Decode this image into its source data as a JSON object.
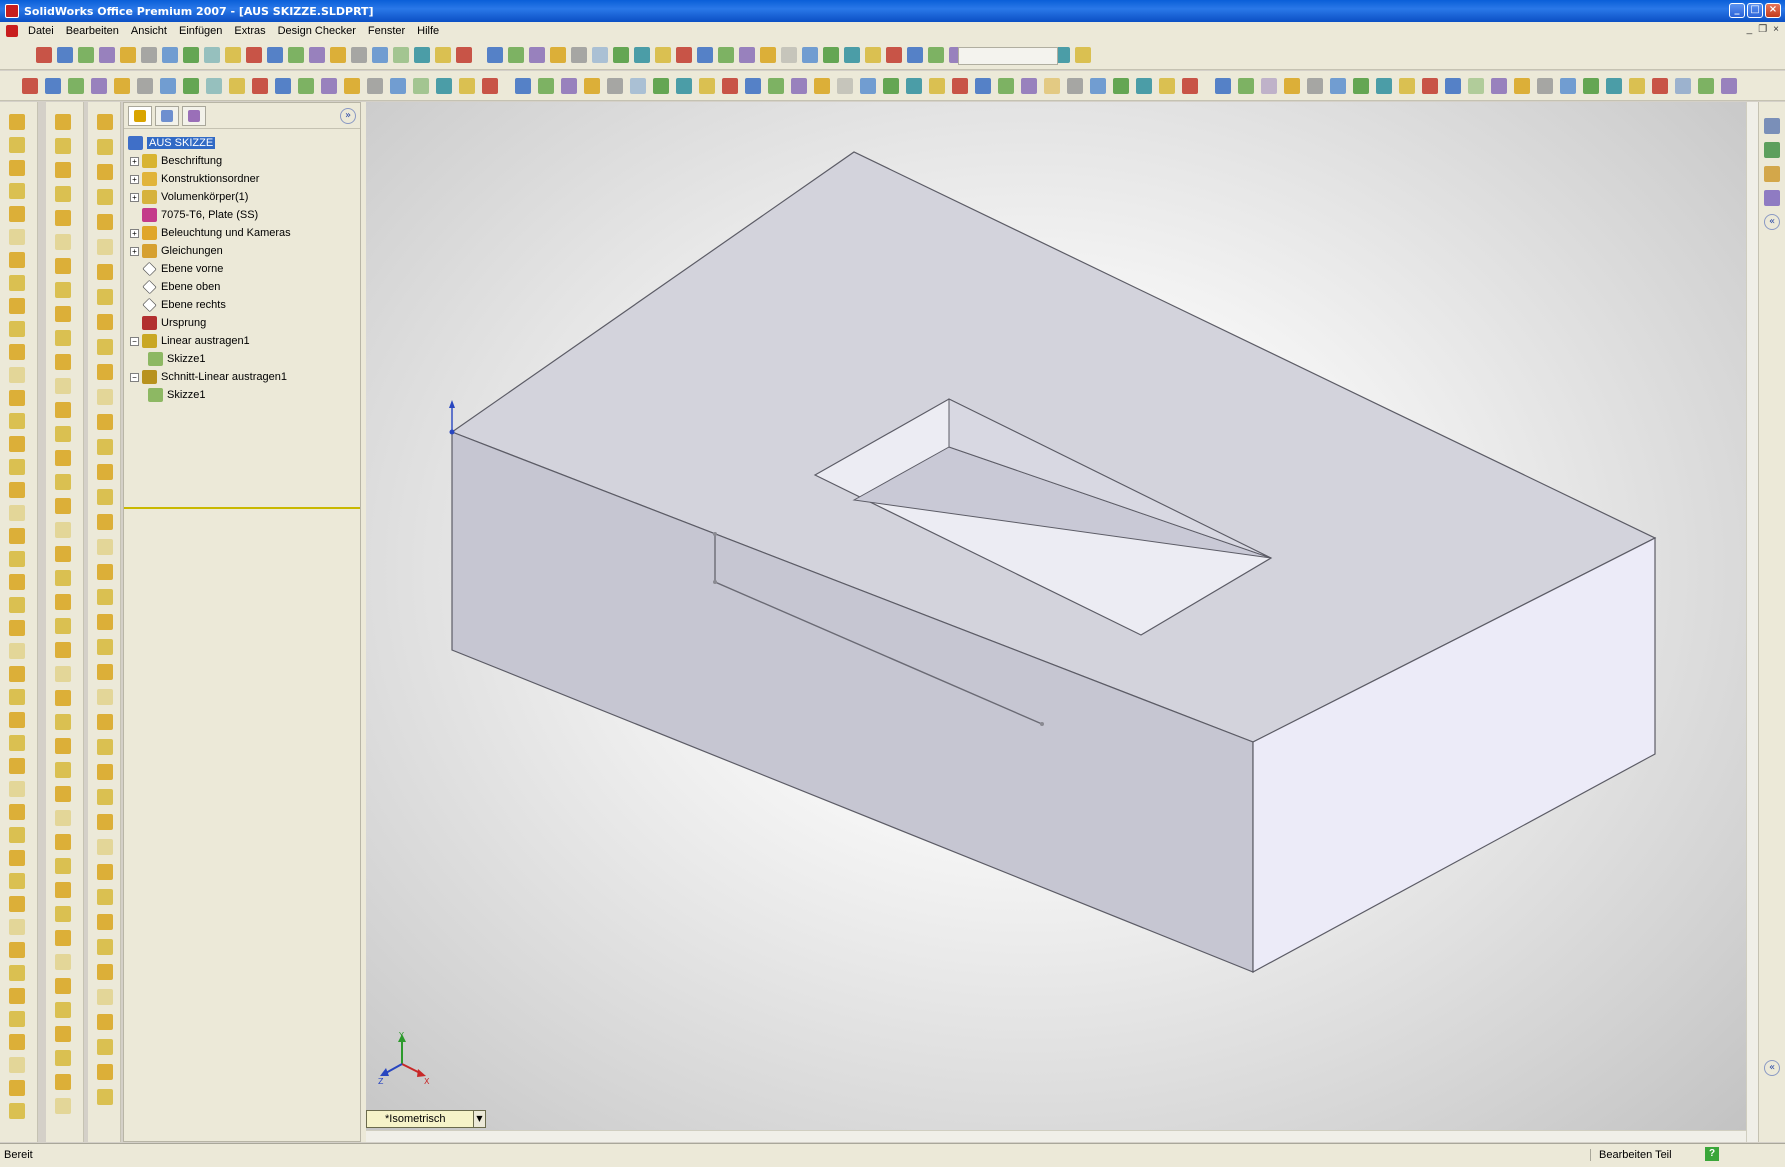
{
  "window": {
    "title": "SolidWorks Office Premium 2007 - [AUS SKIZZE.SLDPRT]",
    "controls": [
      "_",
      "□",
      "×"
    ],
    "doc_controls": [
      "_",
      "❐",
      "×"
    ]
  },
  "menu": {
    "items": [
      "Datei",
      "Bearbeiten",
      "Ansicht",
      "Einfügen",
      "Extras",
      "Design Checker",
      "Fenster",
      "Hilfe"
    ]
  },
  "feature_tree": {
    "tabs": [
      "feature-manager-icon",
      "property-manager-icon",
      "configuration-manager-icon"
    ],
    "collapse_label": "»",
    "items": [
      {
        "label": "AUS SKIZZE",
        "expander": "",
        "icon": "part-icon",
        "indent": 0,
        "selected": true
      },
      {
        "label": "Beschriftung",
        "expander": "+",
        "icon": "annotations-icon",
        "indent": 1
      },
      {
        "label": "Konstruktionsordner",
        "expander": "+",
        "icon": "design-binder-icon",
        "indent": 1
      },
      {
        "label": "Volumenkörper(1)",
        "expander": "+",
        "icon": "solid-bodies-icon",
        "indent": 1
      },
      {
        "label": "7075-T6, Plate (SS)",
        "expander": "",
        "icon": "material-icon",
        "indent": 1
      },
      {
        "label": "Beleuchtung und Kameras",
        "expander": "+",
        "icon": "lights-cameras-icon",
        "indent": 1
      },
      {
        "label": "Gleichungen",
        "expander": "+",
        "icon": "equations-icon",
        "indent": 1
      },
      {
        "label": "Ebene vorne",
        "expander": "",
        "icon": "plane-icon",
        "indent": 1
      },
      {
        "label": "Ebene oben",
        "expander": "",
        "icon": "plane-icon",
        "indent": 1
      },
      {
        "label": "Ebene rechts",
        "expander": "",
        "icon": "plane-icon",
        "indent": 1
      },
      {
        "label": "Ursprung",
        "expander": "",
        "icon": "origin-icon",
        "indent": 1
      },
      {
        "label": "Linear austragen1",
        "expander": "−",
        "icon": "extrude-boss-icon",
        "indent": 1
      },
      {
        "label": "Skizze1",
        "expander": "",
        "icon": "sketch-icon",
        "indent": 2
      },
      {
        "label": "Schnitt-Linear austragen1",
        "expander": "−",
        "icon": "extrude-cut-icon",
        "indent": 1
      },
      {
        "label": "Skizze1",
        "expander": "",
        "icon": "sketch-icon",
        "indent": 2
      }
    ]
  },
  "graphics": {
    "view_orientation": "*Isometrisch",
    "triad_axes": [
      "X",
      "Y",
      "Z"
    ],
    "model_colors": {
      "top": "#d3d3dc",
      "front": "#c6c6d2",
      "right": "#ecebf8",
      "edge": "#5c5c66"
    }
  },
  "statusbar": {
    "left": "Bereit",
    "mode": "Bearbeiten Teil",
    "help": "?"
  }
}
